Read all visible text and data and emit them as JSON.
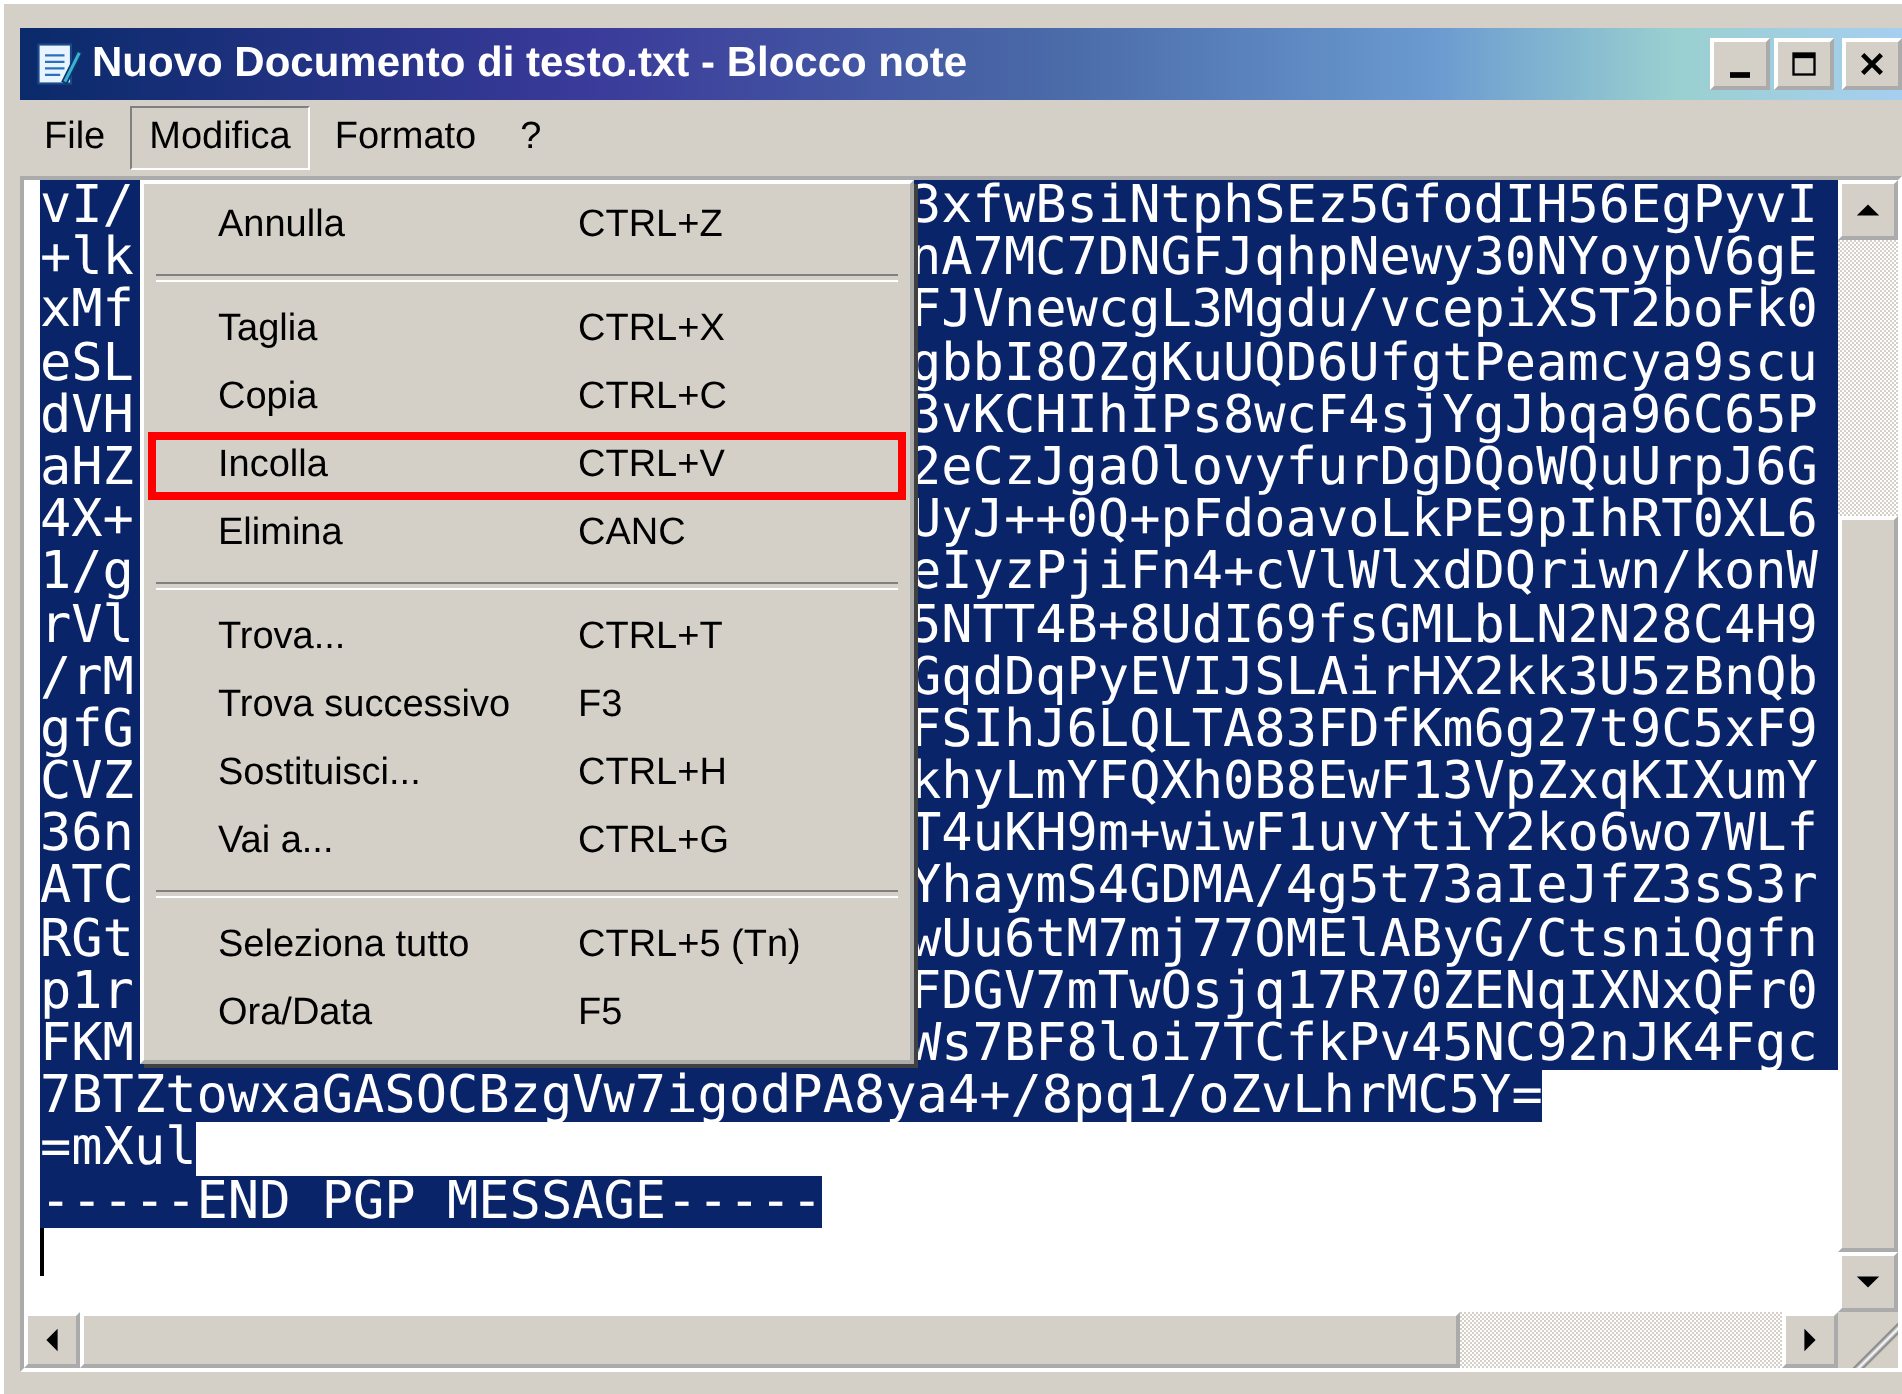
{
  "window": {
    "title": "Nuovo Documento di testo.txt - Blocco note"
  },
  "menu_bar": [
    {
      "label": "File",
      "selected": false
    },
    {
      "label": "Modifica",
      "selected": true
    },
    {
      "label": "Formato",
      "selected": false
    },
    {
      "label": "?",
      "selected": false
    }
  ],
  "edit_menu": {
    "items": [
      {
        "kind": "item",
        "label": "Annulla",
        "shortcut": "CTRL+Z",
        "highlighted": false
      },
      {
        "kind": "separator"
      },
      {
        "kind": "item",
        "label": "Taglia",
        "shortcut": "CTRL+X",
        "highlighted": false
      },
      {
        "kind": "item",
        "label": "Copia",
        "shortcut": "CTRL+C",
        "highlighted": false
      },
      {
        "kind": "item",
        "label": "Incolla",
        "shortcut": "CTRL+V",
        "highlighted": true
      },
      {
        "kind": "item",
        "label": "Elimina",
        "shortcut": "CANC",
        "highlighted": false
      },
      {
        "kind": "separator"
      },
      {
        "kind": "item",
        "label": "Trova...",
        "shortcut": "CTRL+T",
        "highlighted": false
      },
      {
        "kind": "item",
        "label": "Trova successivo",
        "shortcut": "F3",
        "highlighted": false
      },
      {
        "kind": "item",
        "label": "Sostituisci...",
        "shortcut": "CTRL+H",
        "highlighted": false
      },
      {
        "kind": "item",
        "label": "Vai a...",
        "shortcut": "CTRL+G",
        "highlighted": false
      },
      {
        "kind": "separator"
      },
      {
        "kind": "item",
        "label": "Seleziona tutto",
        "shortcut": "CTRL+5 (Tn)",
        "highlighted": false
      },
      {
        "kind": "item",
        "label": "Ora/Data",
        "shortcut": "F5",
        "highlighted": false
      }
    ]
  },
  "editor": {
    "selected": true,
    "lines": [
      {
        "kind": "split",
        "left": "vI/",
        "right": "3xfwBsiNtphSEz5GfodIH56EgPyvI"
      },
      {
        "kind": "split",
        "left": "+lk",
        "right": "nA7MC7DNGFJqhpNewy30NYoypV6gE"
      },
      {
        "kind": "split",
        "left": "xMf",
        "right": "FJVnewcgL3Mgdu/vcepiXST2boFk0"
      },
      {
        "kind": "split",
        "left": "eSL",
        "right": "gbbI8OZgKuUQD6UfgtPeamcya9scu"
      },
      {
        "kind": "split",
        "left": "dVH",
        "right": "3vKCHIhIPs8wcF4sjYgJbqa96C65P"
      },
      {
        "kind": "split",
        "left": "aHZ",
        "right": "2eCzJgaOlovyfurDgDQoWQuUrpJ6G"
      },
      {
        "kind": "split",
        "left": "4X+",
        "right": "UyJ++0Q+pFdoavoLkPE9pIhRT0XL6"
      },
      {
        "kind": "split",
        "left": "1/g",
        "right": "eIyzPjiFn4+cVlWlxdDQriwn/konW"
      },
      {
        "kind": "split",
        "left": "rVl",
        "right": "5NTT4B+8UdI69fsGMLbLN2N28C4H9"
      },
      {
        "kind": "split",
        "left": "/rM",
        "right": "GqdDqPyEVIJSLAirHX2kk3U5zBnQb"
      },
      {
        "kind": "split",
        "left": "gfG",
        "right": "FSIhJ6LQLTA83FDfKm6g27t9C5xF9"
      },
      {
        "kind": "split",
        "left": "CVZ",
        "right": "khyLmYFQXh0B8EwF13VpZxqKIXumY"
      },
      {
        "kind": "split",
        "left": "36n",
        "right": "T4uKH9m+wiwF1uvYtiY2ko6wo7WLf"
      },
      {
        "kind": "split",
        "left": "ATC",
        "right": "YhaymS4GDMA/4g5t73aIeJfZ3sS3r"
      },
      {
        "kind": "split",
        "left": "RGt",
        "right": "wUu6tM7mj77OMElAByG/CtsniQgfn"
      },
      {
        "kind": "split",
        "left": "p1r",
        "right": "FDGV7mTwOsjq17R70ZENqIXNxQFr0"
      },
      {
        "kind": "split",
        "left": "FKM",
        "right": "Ws7BF8loi7TCfkPv45NC92nJK4Fgc"
      },
      {
        "kind": "full",
        "text": "7BTZtowxaGASOCBzgVw7igodPA8ya4+/8pq1/oZvLhrMC5Y="
      },
      {
        "kind": "full",
        "text": "=mXul"
      },
      {
        "kind": "full",
        "text": "-----END PGP MESSAGE-----"
      }
    ]
  }
}
